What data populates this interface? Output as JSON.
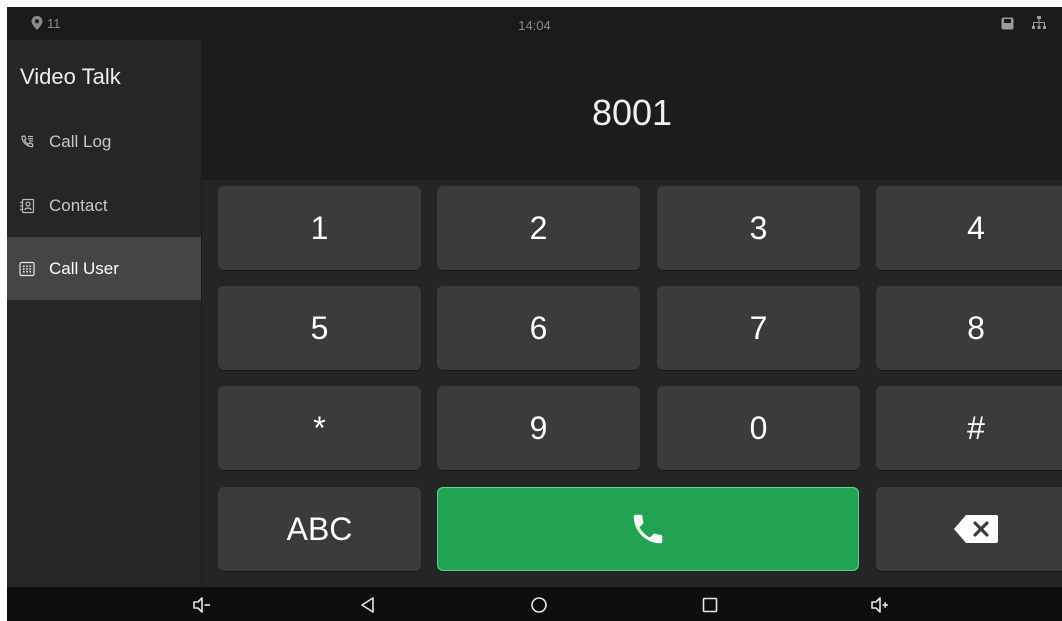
{
  "status_bar": {
    "notification_count": "11",
    "time": "14:04",
    "icons": [
      "location-pin-icon",
      "sd-card-icon",
      "network-icon"
    ]
  },
  "sidebar": {
    "title": "Video Talk",
    "items": [
      {
        "label": "Call Log",
        "icon": "call-log-icon",
        "active": false
      },
      {
        "label": "Contact",
        "icon": "contact-icon",
        "active": false
      },
      {
        "label": "Call User",
        "icon": "dialpad-icon",
        "active": true
      }
    ]
  },
  "dialer": {
    "number": "8001",
    "keys": [
      "1",
      "2",
      "3",
      "4",
      "5",
      "6",
      "7",
      "8",
      "*",
      "9",
      "0",
      "#"
    ],
    "abc_label": "ABC",
    "call_icon": "phone-icon",
    "delete_icon": "backspace-icon"
  },
  "navigation_bar": {
    "icons": [
      "volume-down-icon",
      "back-icon",
      "home-icon",
      "recents-icon",
      "volume-up-icon"
    ]
  },
  "colors": {
    "call_button": "#21a352",
    "key_background": "#3b3b3b",
    "active_nav": "#454545"
  }
}
